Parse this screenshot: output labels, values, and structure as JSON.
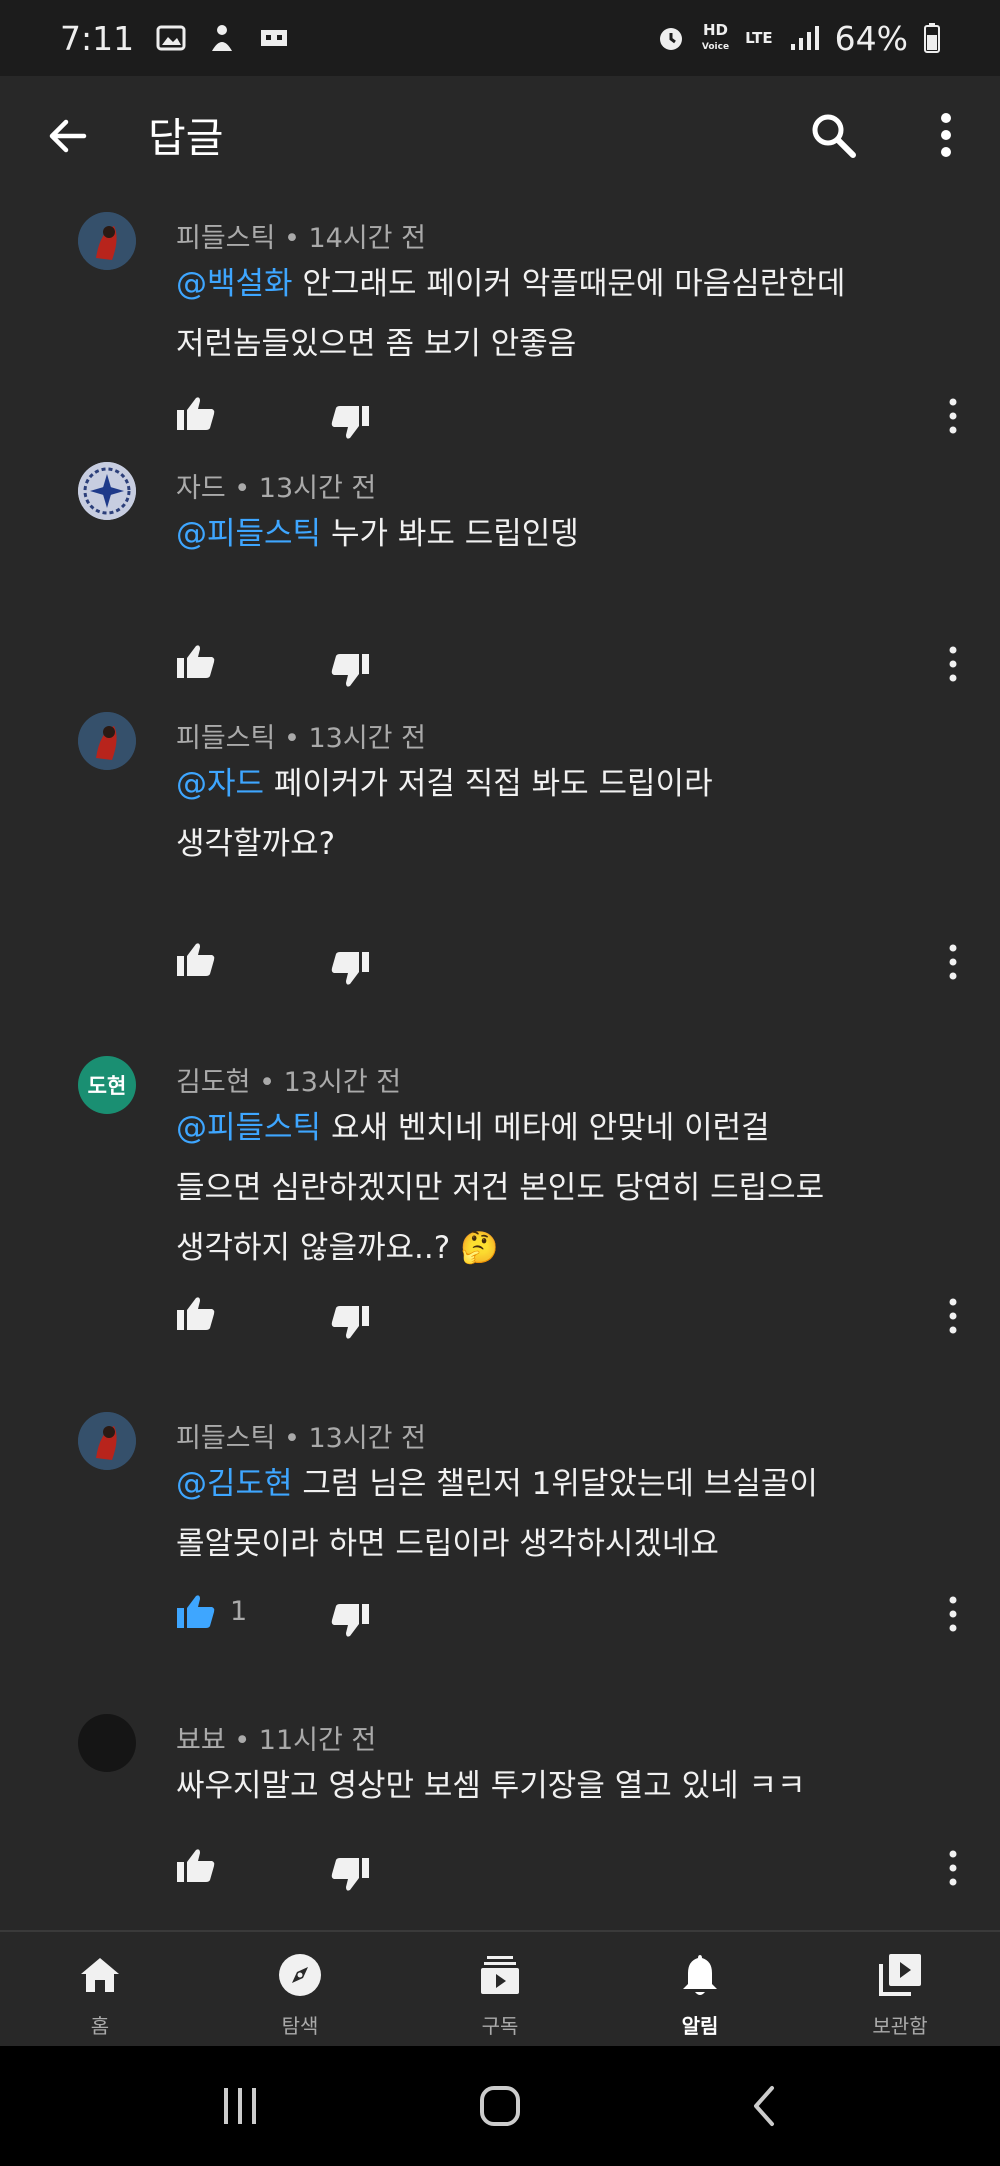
{
  "status": {
    "time": "7:11",
    "battery": "64%",
    "hd": "HD",
    "hd_sub": "Voice",
    "lte": "LTE"
  },
  "appbar": {
    "title": "답글"
  },
  "comments": [
    {
      "author": "피들스틱",
      "time": "14시간 전",
      "mention": "@백설화",
      "text": " 안그래도 페이커 악플때문에 마음심란한데\n저런놈들있으면 좀 보기 안좋음",
      "likes": ""
    },
    {
      "author": "자드",
      "time": "13시간 전",
      "mention": "@피들스틱",
      "text": " 누가 봐도 드립인뎅",
      "likes": ""
    },
    {
      "author": "피들스틱",
      "time": "13시간 전",
      "mention": "@자드",
      "text": " 페이커가 저걸 직접 봐도 드립이라\n생각할까요?",
      "likes": ""
    },
    {
      "author": "김도현",
      "avatar_text": "도현",
      "time": "13시간 전",
      "mention": "@피들스틱",
      "text": " 요새 벤치네 메타에 안맞네 이런걸\n들으면 심란하겠지만 저건 본인도 당연히 드립으로\n생각하지 않을까요..? 🤔",
      "likes": ""
    },
    {
      "author": "피들스틱",
      "time": "13시간 전",
      "mention": "@김도현",
      "text": " 그럼 님은 챌린저 1위달았는데 브실골이\n롤알못이라 하면 드립이라 생각하시겠네요",
      "likes": "1"
    },
    {
      "author": "뵤뵤",
      "time": "11시간 전",
      "mention": "",
      "text": "싸우지말고 영상만 보셈 투기장을 열고 있네 ㅋㅋ",
      "likes": ""
    }
  ],
  "meta_sep": " • ",
  "nav": [
    {
      "label": "홈",
      "icon": "home-icon"
    },
    {
      "label": "탐색",
      "icon": "explore-icon"
    },
    {
      "label": "구독",
      "icon": "subscriptions-icon"
    },
    {
      "label": "알림",
      "icon": "bell-icon",
      "active": true
    },
    {
      "label": "보관함",
      "icon": "library-icon"
    }
  ],
  "colors": {
    "mention": "#3ea6ff",
    "liked": "#3ea6ff",
    "avatar_green": "#1a8f72"
  }
}
